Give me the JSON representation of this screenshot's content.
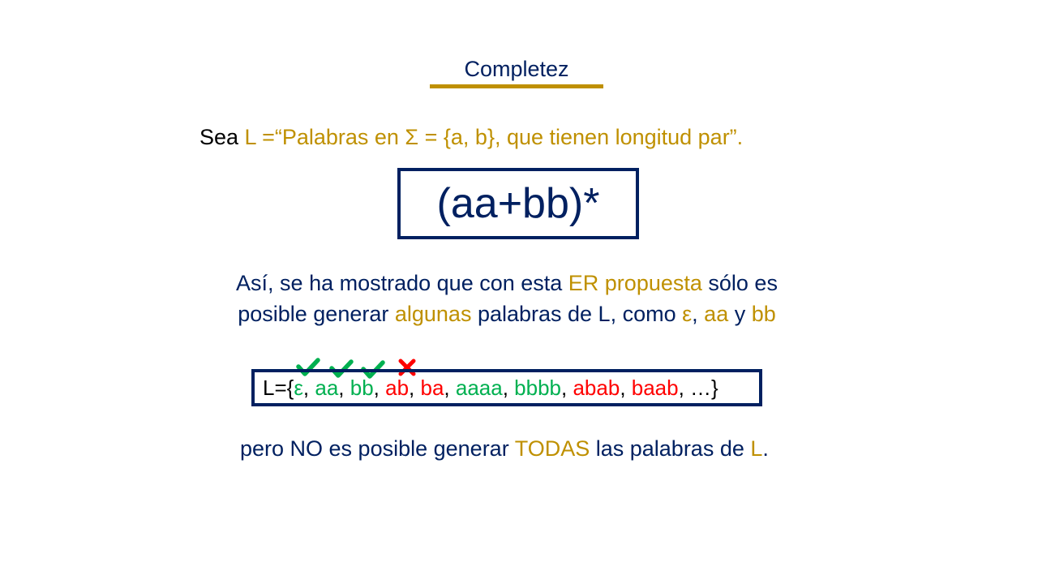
{
  "title": "Completez",
  "definition": {
    "prefix": "Sea ",
    "lang_name": "L =",
    "quote": "“Palabras en Σ = {a, b}, que tienen longitud par”."
  },
  "regex": "(aa+bb)*",
  "explanation": {
    "line1": [
      "Así, se ha mostrado que con esta ",
      "ER propuesta",
      " sólo es"
    ],
    "line2": [
      "posible generar ",
      "algunas",
      " palabras de L, como ",
      "ε",
      ", ",
      "aa",
      " y ",
      "bb"
    ]
  },
  "language": {
    "prefix": "L={",
    "suffix": ", …}",
    "words": [
      {
        "text": "ε",
        "status": "generated",
        "mark": "check"
      },
      {
        "text": "aa",
        "status": "generated",
        "mark": "check"
      },
      {
        "text": "bb",
        "status": "generated",
        "mark": "check"
      },
      {
        "text": "ab",
        "status": "not-generated",
        "mark": "cross"
      },
      {
        "text": "ba",
        "status": "not-generated"
      },
      {
        "text": "aaaa",
        "status": "generated"
      },
      {
        "text": "bbbb",
        "status": "generated"
      },
      {
        "text": "abab",
        "status": "not-generated"
      },
      {
        "text": "baab",
        "status": "not-generated"
      }
    ]
  },
  "conclusion": [
    "pero NO es posible generar ",
    "TODAS",
    " las palabras de ",
    "L",
    "."
  ],
  "colors": {
    "navy": "#002060",
    "gold": "#BF9000",
    "green": "#00B050",
    "red": "#FF0000"
  }
}
